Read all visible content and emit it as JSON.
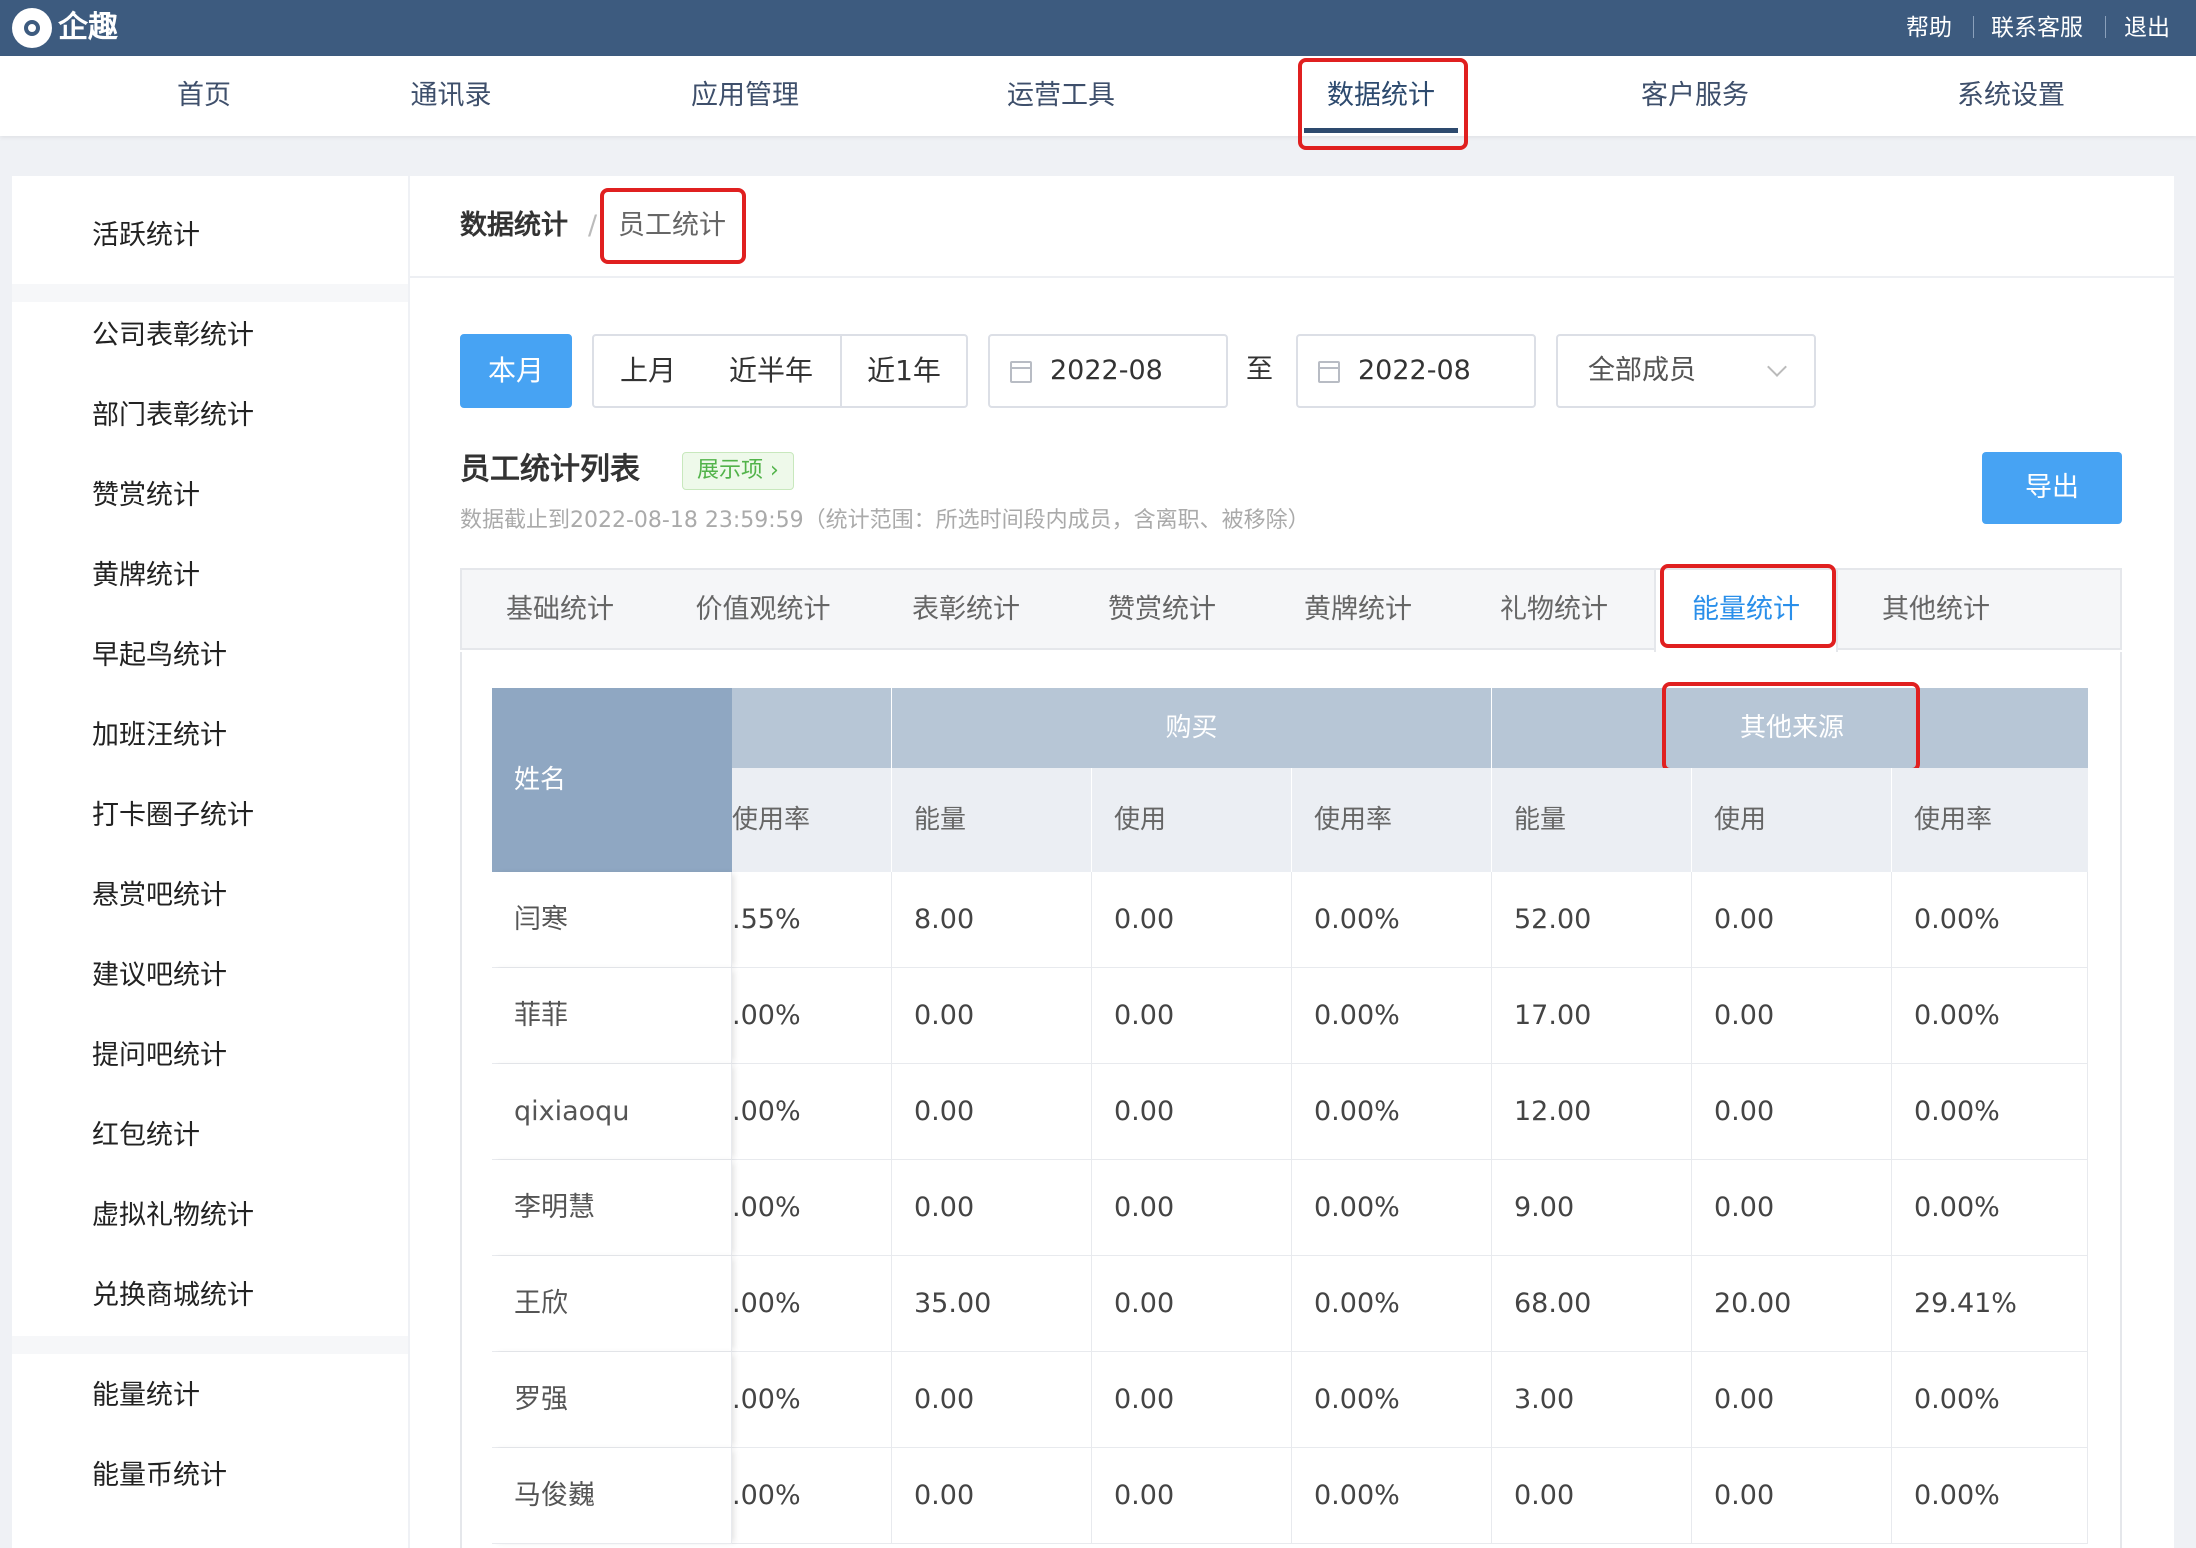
{
  "topbar": {
    "brand": "企趣",
    "links": [
      "帮助",
      "联系客服",
      "退出"
    ]
  },
  "nav": {
    "items": [
      "首页",
      "通讯录",
      "应用管理",
      "运营工具",
      "数据统计",
      "客户服务",
      "系统设置"
    ],
    "active": "数据统计"
  },
  "sidebar": {
    "items": [
      "活跃统计",
      "公司表彰统计",
      "部门表彰统计",
      "赞赏统计",
      "黄牌统计",
      "早起鸟统计",
      "加班汪统计",
      "打卡圈子统计",
      "悬赏吧统计",
      "建议吧统计",
      "提问吧统计",
      "红包统计",
      "虚拟礼物统计",
      "兑换商城统计",
      "能量统计",
      "能量币统计"
    ]
  },
  "breadcrumb": {
    "root": "数据统计",
    "sep": "/",
    "current": "员工统计"
  },
  "filters": {
    "period_buttons": [
      "本月",
      "上月",
      "近半年",
      "近1年"
    ],
    "active_period": "本月",
    "start_date": "2022-08",
    "to_label": "至",
    "end_date": "2022-08",
    "member_select": "全部成员"
  },
  "list": {
    "title": "员工统计列表",
    "display_items_tag": "展示项",
    "export_button": "导出",
    "note": "数据截止到2022-08-18 23:59:59（统计范围：所选时间段内成员，含离职、被移除）"
  },
  "tabs": {
    "items": [
      "基础统计",
      "价值观统计",
      "表彰统计",
      "赞赏统计",
      "黄牌统计",
      "礼物统计",
      "能量统计",
      "其他统计"
    ],
    "active": "能量统计"
  },
  "table": {
    "name_header": "姓名",
    "groups": [
      "",
      "购买",
      "其他来源"
    ],
    "sub_headers": [
      "使用率",
      "能量",
      "使用",
      "使用率",
      "能量",
      "使用",
      "使用率"
    ],
    "rows": [
      {
        "name": "闫寒",
        "cells": [
          ".55%",
          "8.00",
          "0.00",
          "0.00%",
          "52.00",
          "0.00",
          "0.00%"
        ]
      },
      {
        "name": "菲菲",
        "cells": [
          ".00%",
          "0.00",
          "0.00",
          "0.00%",
          "17.00",
          "0.00",
          "0.00%"
        ]
      },
      {
        "name": "qixiaoqu",
        "cells": [
          ".00%",
          "0.00",
          "0.00",
          "0.00%",
          "12.00",
          "0.00",
          "0.00%"
        ]
      },
      {
        "name": "李明慧",
        "cells": [
          ".00%",
          "0.00",
          "0.00",
          "0.00%",
          "9.00",
          "0.00",
          "0.00%"
        ]
      },
      {
        "name": "王欣",
        "cells": [
          ".00%",
          "35.00",
          "0.00",
          "0.00%",
          "68.00",
          "20.00",
          "29.41%"
        ]
      },
      {
        "name": "罗强",
        "cells": [
          ".00%",
          "0.00",
          "0.00",
          "0.00%",
          "3.00",
          "0.00",
          "0.00%"
        ]
      },
      {
        "name": "马俊巍",
        "cells": [
          ".00%",
          "0.00",
          "0.00",
          "0.00%",
          "0.00",
          "0.00",
          "0.00%"
        ]
      }
    ]
  },
  "colors": {
    "topbar": "#3d5b7f",
    "accent": "#47a3f3",
    "highlight": "#e02020",
    "table_header": "#b7c6d6",
    "active_tab": "#2a8fea"
  }
}
